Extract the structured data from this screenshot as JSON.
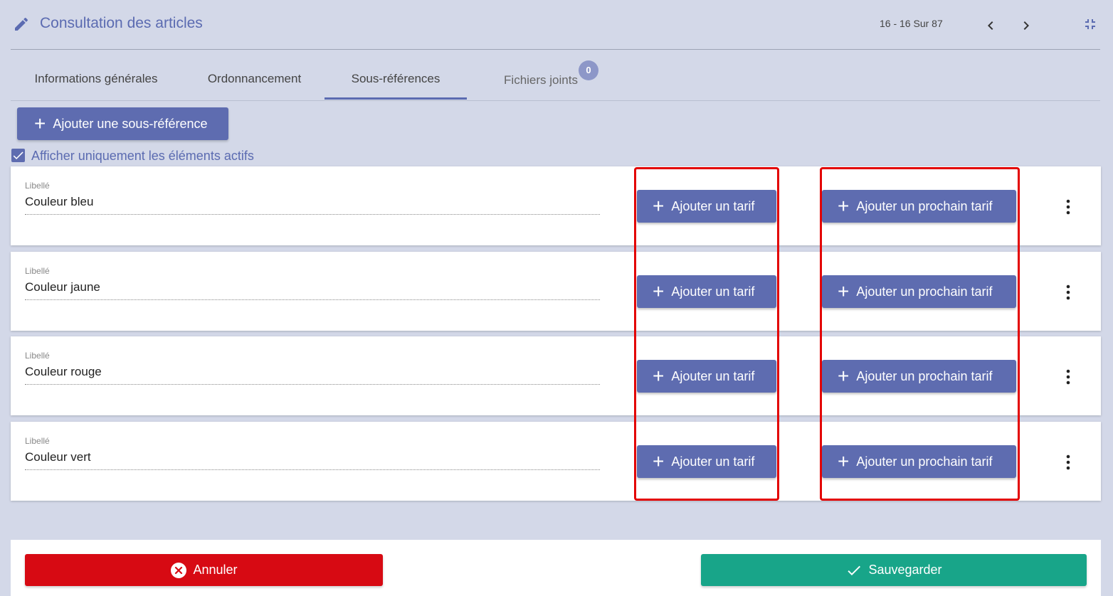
{
  "header": {
    "title": "Consultation des articles",
    "pager": "16 - 16 Sur 87"
  },
  "tabs": [
    {
      "label": "Informations générales"
    },
    {
      "label": "Ordonnancement"
    },
    {
      "label": "Sous-références"
    },
    {
      "label": "Fichiers joints",
      "badge": "0"
    }
  ],
  "toolbar": {
    "add_label": "Ajouter une sous-référence",
    "filter_label": "Afficher uniquement les éléments actifs"
  },
  "rows": [
    {
      "field_label": "Libellé",
      "value": "Couleur bleu"
    },
    {
      "field_label": "Libellé",
      "value": "Couleur jaune"
    },
    {
      "field_label": "Libellé",
      "value": "Couleur rouge"
    },
    {
      "field_label": "Libellé",
      "value": "Couleur vert"
    }
  ],
  "row_buttons": {
    "add_tarif": "Ajouter un tarif",
    "add_next_tarif": "Ajouter un prochain tarif"
  },
  "footer": {
    "cancel_label": "Annuler",
    "save_label": "Sauvegarder"
  },
  "colors": {
    "accent": "#5e6cb0",
    "danger": "#d70a13",
    "success": "#18a589",
    "highlight": "#e30000"
  }
}
